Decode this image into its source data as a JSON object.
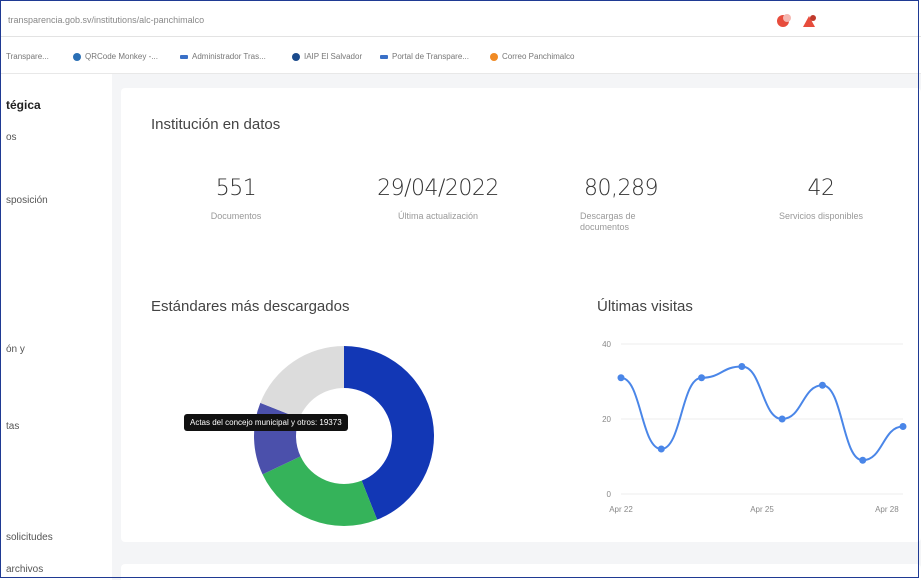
{
  "browser": {
    "url": "transparencia.gob.sv/institutions/alc-panchimalco",
    "bookmarks": [
      {
        "label": "Transpare...",
        "color": "#1f3a93"
      },
      {
        "label": "QRCode Monkey -...",
        "color": "#2a6fb5"
      },
      {
        "label": "Administrador Tras...",
        "color": "#3a70c7"
      },
      {
        "label": "IAIP El Salvador",
        "color": "#1b4b8c"
      },
      {
        "label": "Portal de Transpare...",
        "color": "#3a70c7"
      },
      {
        "label": "Correo Panchimalco",
        "color": "#f08a24"
      }
    ]
  },
  "sidebar": {
    "items": [
      "tégica",
      "os",
      "sposición",
      "ón y",
      "tas",
      "solicitudes",
      "archivos"
    ]
  },
  "institution": {
    "heading": "Institución en datos",
    "stats": [
      {
        "value": "551",
        "label": "Documentos"
      },
      {
        "value": "29/04/2022",
        "label": "Última actualización"
      },
      {
        "value": "80,289",
        "label": "Descargas de documentos"
      },
      {
        "value": "42",
        "label": "Servicios disponibles"
      }
    ]
  },
  "donut": {
    "heading": "Estándares más descargados",
    "tooltip": "Actas del concejo municipal y otros: 19373"
  },
  "visits": {
    "heading": "Últimas visitas"
  },
  "chart_data": [
    {
      "type": "pie",
      "title": "Estándares más descargados",
      "slices": [
        {
          "value": 44,
          "color": "#1237b5"
        },
        {
          "value": 24,
          "color": "#35b35a"
        },
        {
          "value": 13,
          "color": "#4b50ab"
        },
        {
          "value": 19,
          "color": "#dcdcdc"
        }
      ],
      "annotation": "Actas del concejo municipal y otros: 19373"
    },
    {
      "type": "line",
      "title": "Últimas visitas",
      "x": [
        "Apr 22",
        "",
        "",
        "",
        "",
        "Apr 25",
        "",
        "",
        "",
        "",
        "Apr 28",
        ""
      ],
      "x_ticks": [
        "Apr 22",
        "Apr 25",
        "Apr 28"
      ],
      "y": [
        31,
        12,
        31,
        34,
        20,
        29,
        9,
        18
      ],
      "ylim": [
        0,
        40
      ],
      "y_ticks": [
        0,
        20,
        40
      ],
      "color": "#4a86e8"
    }
  ]
}
